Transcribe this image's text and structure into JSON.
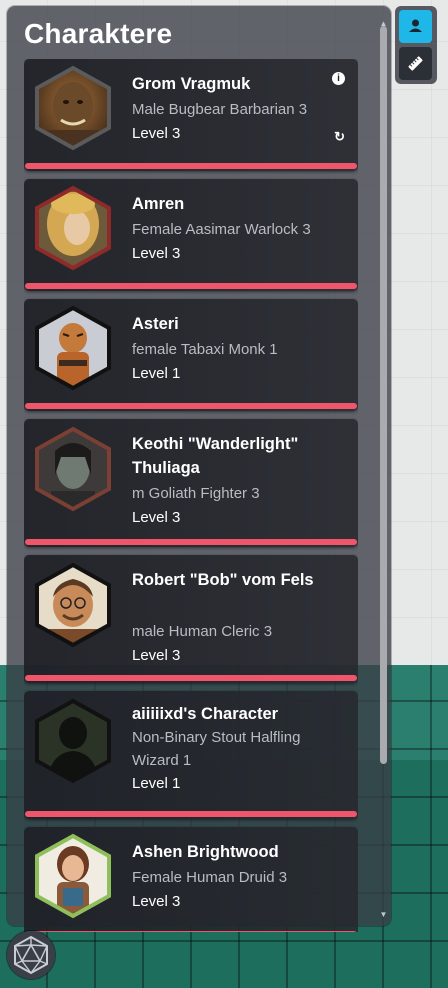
{
  "panel": {
    "title": "Charaktere"
  },
  "colors": {
    "health_bar": "#f0566b",
    "toolbar_active": "#1fb7e8",
    "panel_bg": "#3a3e46"
  },
  "characters": [
    {
      "name": "Grom Vragmuk",
      "name2": "",
      "desc": "Male Bugbear Barbarian 3",
      "desc2": "",
      "level": "Level 3",
      "avatar_border": "#5b5b5b",
      "icons": [
        "info-icon",
        "refresh-icon"
      ]
    },
    {
      "name": "Amren",
      "name2": "",
      "desc": "Female Aasimar Warlock 3",
      "desc2": "",
      "level": "Level 3",
      "avatar_border": "#8f2a2a",
      "icons": []
    },
    {
      "name": "Asteri",
      "name2": "",
      "desc": "female Tabaxi Monk 1",
      "desc2": "",
      "level": "Level 1",
      "avatar_border": "#111111",
      "icons": []
    },
    {
      "name": "Keothi \"Wanderlight\"",
      "name2": "Thuliaga",
      "desc": "m Goliath Fighter 3",
      "desc2": "",
      "level": "Level 3",
      "avatar_border": "#7b3f33",
      "icons": []
    },
    {
      "name": "Robert \"Bob\" vom Fels",
      "name2": "",
      "desc": "male Human Cleric 3",
      "desc2": "",
      "level": "Level 3",
      "avatar_border": "#111111",
      "icons": []
    },
    {
      "name": "aiiiiixd's Character",
      "name2": "",
      "desc": "Non-Binary Stout Halfling",
      "desc2": "Wizard 1",
      "level": "Level 1",
      "avatar_border": "#111111",
      "icons": []
    },
    {
      "name": "Ashen Brightwood",
      "name2": "",
      "desc": "Female Human Druid 3",
      "desc2": "",
      "level": "Level 3",
      "avatar_border": "#8fbf5a",
      "icons": []
    }
  ],
  "toolbar": {
    "items": [
      {
        "icon": "person-icon",
        "active": true
      },
      {
        "icon": "ruler-icon",
        "active": false
      }
    ]
  },
  "dice_button": {
    "icon": "d20-icon"
  }
}
